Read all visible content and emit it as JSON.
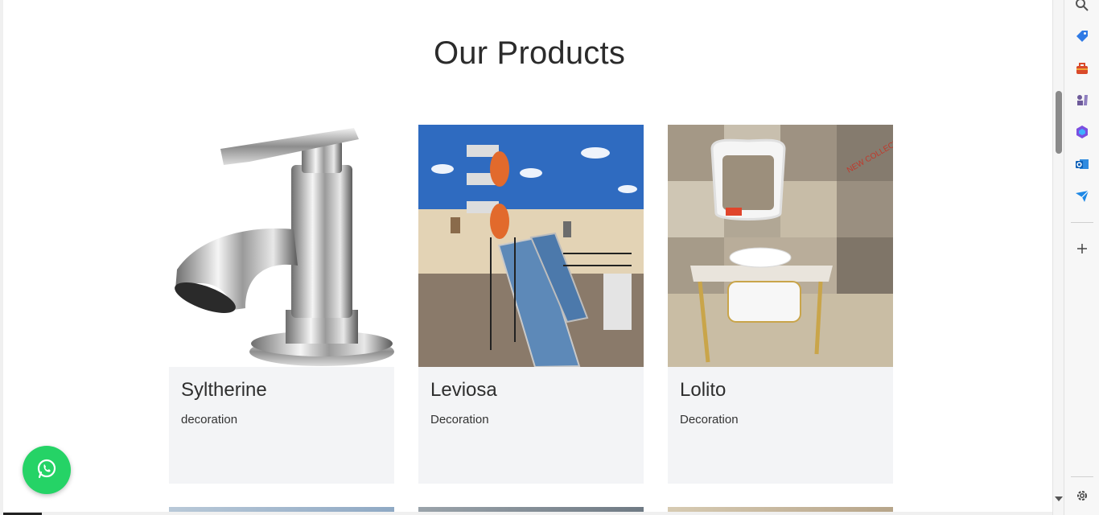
{
  "section": {
    "title": "Our Products"
  },
  "products": [
    {
      "name": "Syltherine",
      "category": "decoration"
    },
    {
      "name": "Leviosa",
      "category": "Decoration"
    },
    {
      "name": "Lolito",
      "category": "Decoration"
    }
  ],
  "whatsapp": {
    "icon": "whatsapp-icon",
    "color": "#25d366"
  },
  "edge_sidebar": {
    "icons": [
      "search-icon",
      "tag-icon",
      "toolbox-icon",
      "chess-icon",
      "copilot-icon",
      "outlook-icon",
      "send-icon",
      "plus-icon",
      "settings-icon"
    ]
  }
}
